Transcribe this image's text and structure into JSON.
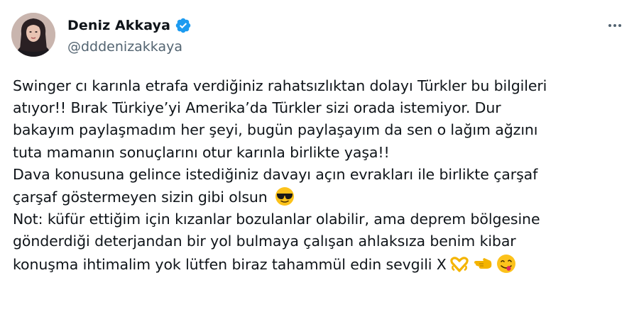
{
  "author": {
    "display_name": "Deniz Akkaya",
    "handle": "@dddenizakkaya",
    "verified": true
  },
  "colors": {
    "verified_badge": "#1d9bf0",
    "text_primary": "#0f1419",
    "text_secondary": "#536471"
  },
  "tweet": {
    "lines": [
      "Swinger cı karınla etrafa verdiğiniz rahatsızlıktan dolayı Türkler bu bilgileri",
      "atıyor!! Bırak Türkiye’yi Amerika’da Türkler sizi orada istemiyor. Dur",
      "bakayım paylaşmadım her şeyi, bugün paylaşayım da sen o lağım ağzını",
      "tuta mamanın sonuçlarını otur karınla birlikte yaşa!!",
      "Dava konusuna gelince istediğiniz davayı açın evrakları ile birlikte çarşaf",
      "çarşaf göstermeyen sizin gibi olsun",
      "Not: küfür ettiğim için kızanlar bozulanlar olabilir, ama deprem bölgesine",
      "gönderdiği deterjandan bir yol bulmaya çalışan ahlaksıza benim kibar",
      "konuşma ihtimalim yok lütfen biraz tahammül edin sevgili X"
    ],
    "emojis": {
      "line6": "sunglasses-face-emoji",
      "line9": [
        "heart-hands-emoji",
        "left-pointing-hand-emoji",
        "face-savoring-food-emoji"
      ]
    }
  },
  "icons": {
    "more": "more-horizontal-icon",
    "verified": "verified-badge-icon"
  }
}
